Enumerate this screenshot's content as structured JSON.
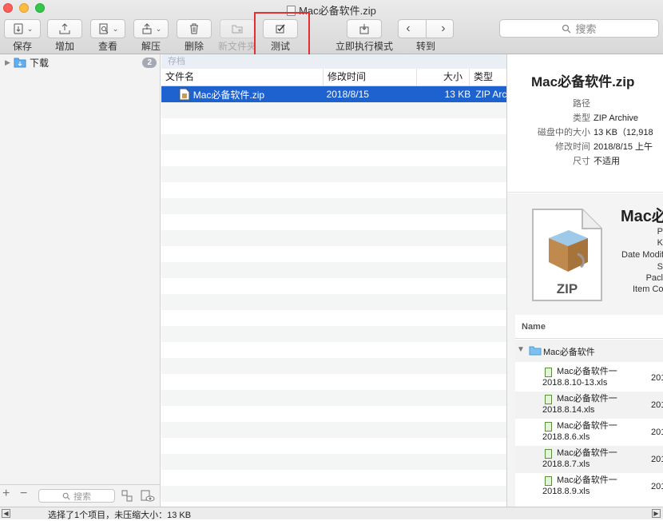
{
  "window": {
    "title": "Mac必备软件.zip"
  },
  "toolbar": {
    "save": "保存",
    "add": "增加",
    "view": "查看",
    "extract": "解压",
    "delete": "删除",
    "new_folder": "新文件夹",
    "test": "测试",
    "exec_mode": "立即执行模式",
    "goto": "转到",
    "search_placeholder": "搜索"
  },
  "sidebar": {
    "item_label": "下载",
    "badge": "2",
    "search_placeholder": "搜索"
  },
  "list": {
    "archive_label": "存档",
    "columns": [
      "文件名",
      "修改时间",
      "大小",
      "类型"
    ],
    "rows": [
      {
        "name": "Mac必备软件.zip",
        "modified": "2018/8/15",
        "size": "13 KB",
        "type": "ZIP Arc"
      }
    ]
  },
  "info": {
    "title": "Mac必备软件.zip",
    "fields": [
      {
        "key": "路径",
        "value": ""
      },
      {
        "key": "类型",
        "value": "ZIP Archive"
      },
      {
        "key": "磁盘中的大小",
        "value": "13 KB（12,918"
      },
      {
        "key": "修改时间",
        "value": "2018/8/15 上午"
      },
      {
        "key": "尺寸",
        "value": "不适用"
      }
    ]
  },
  "preview": {
    "title": "Mac必",
    "icon_label": "ZIP",
    "meta_keys": [
      "P",
      "K",
      "Date Modifi",
      "S",
      "Pacl",
      "Item Co"
    ],
    "table_header": "Name",
    "folder_name": "Mac必备软件",
    "files": [
      {
        "name": "Mac必备软件一2018.8.10-13.xls",
        "date": "201"
      },
      {
        "name": "Mac必备软件一2018.8.14.xls",
        "date": "201"
      },
      {
        "name": "Mac必备软件一2018.8.6.xls",
        "date": "201"
      },
      {
        "name": "Mac必备软件一2018.8.7.xls",
        "date": "201"
      },
      {
        "name": "Mac必备软件一2018.8.9.xls",
        "date": "201"
      }
    ]
  },
  "status": {
    "text": "选择了1个项目，未压缩大小：13 KB"
  }
}
